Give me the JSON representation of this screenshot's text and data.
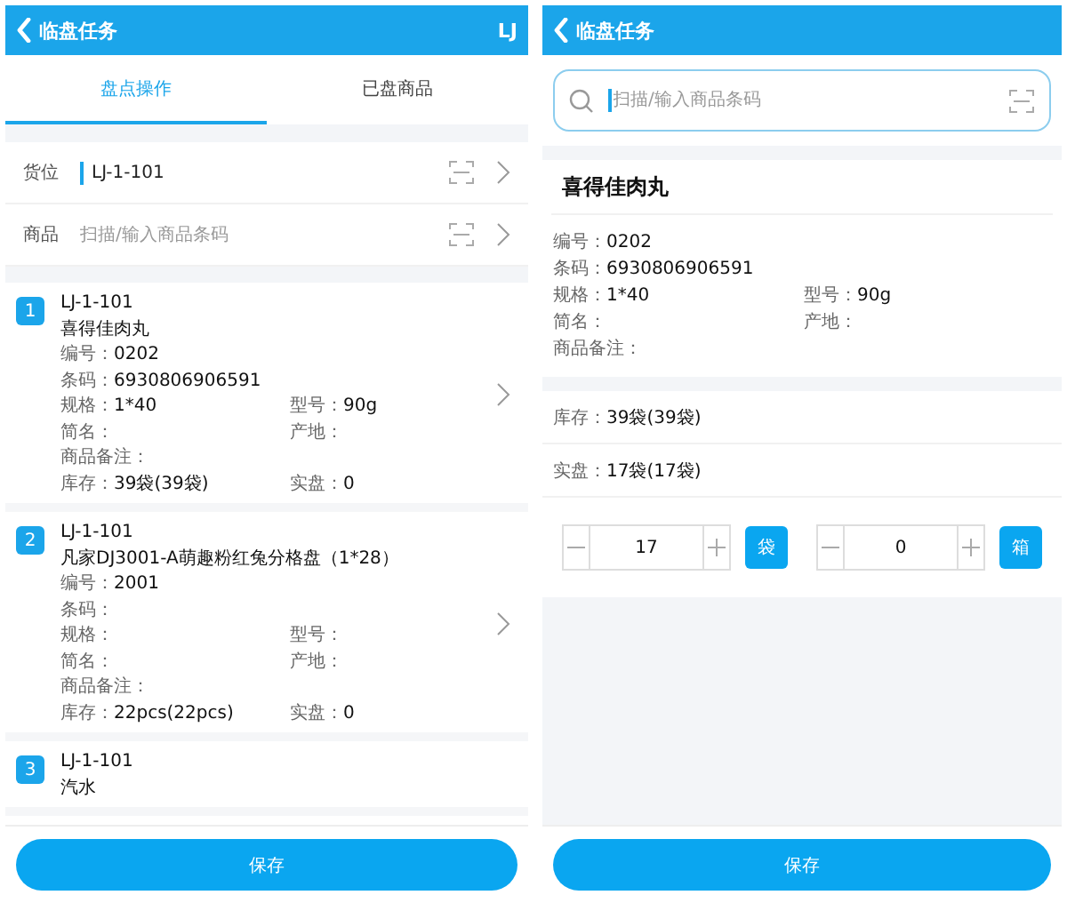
{
  "left": {
    "header": {
      "title": "临盘任务",
      "badge": "LJ"
    },
    "tabs": [
      {
        "label": "盘点操作",
        "selected": true
      },
      {
        "label": "已盘商品",
        "selected": false
      }
    ],
    "fields": [
      {
        "label": "货位",
        "value": "LJ-1-101",
        "focused": true
      },
      {
        "label": "商品",
        "placeholder": "扫描/输入商品条码",
        "focused": false
      }
    ],
    "items": [
      {
        "index": "1",
        "location": "LJ-1-101",
        "name": "喜得佳肉丸",
        "rows": [
          [
            {
              "label": "编号：",
              "value": "0202"
            }
          ],
          [
            {
              "label": "条码：",
              "value": "6930806906591"
            }
          ],
          [
            {
              "label": "规格：",
              "value": "1*40"
            },
            {
              "label": "型号：",
              "value": "90g"
            }
          ],
          [
            {
              "label": "简名："
            },
            {
              "label": "产地："
            }
          ],
          [
            {
              "label": "商品备注："
            }
          ],
          [
            {
              "label": "库存：",
              "value": "39袋(39袋)"
            },
            {
              "label": "实盘：",
              "value": "0"
            }
          ]
        ]
      },
      {
        "index": "2",
        "location": "LJ-1-101",
        "name": "凡家DJ3001-A萌趣粉红兔分格盘（1*28）",
        "rows": [
          [
            {
              "label": "编号：",
              "value": "2001"
            }
          ],
          [
            {
              "label": "条码："
            }
          ],
          [
            {
              "label": "规格："
            },
            {
              "label": "型号："
            }
          ],
          [
            {
              "label": "简名："
            },
            {
              "label": "产地："
            }
          ],
          [
            {
              "label": "商品备注："
            }
          ],
          [
            {
              "label": "库存：",
              "value": "22pcs(22pcs)"
            },
            {
              "label": "实盘：",
              "value": "0"
            }
          ]
        ]
      },
      {
        "index": "3",
        "location": "LJ-1-101",
        "name": "汽水"
      }
    ],
    "save_button": "保存"
  },
  "right": {
    "header": {
      "title": "临盘任务"
    },
    "search": {
      "placeholder": "扫描/输入商品条码",
      "focused": true
    },
    "product": {
      "name": "喜得佳肉丸",
      "rows": [
        [
          {
            "label": "编号：",
            "value": "0202"
          }
        ],
        [
          {
            "label": "条码：",
            "value": "6930806906591"
          }
        ],
        [
          {
            "label": "规格：",
            "value": "1*40"
          },
          {
            "label": "型号：",
            "value": "90g"
          }
        ],
        [
          {
            "label": "简名："
          },
          {
            "label": "产地："
          }
        ],
        [
          {
            "label": "商品备注："
          }
        ]
      ]
    },
    "counts": [
      {
        "label": "库存：",
        "value": "39袋(39袋)"
      },
      {
        "label": "实盘：",
        "value": "17袋(17袋)"
      }
    ],
    "steppers": [
      {
        "value": "17",
        "unit": "袋"
      },
      {
        "value": "0",
        "unit": "箱"
      }
    ],
    "save_button": "保存"
  }
}
